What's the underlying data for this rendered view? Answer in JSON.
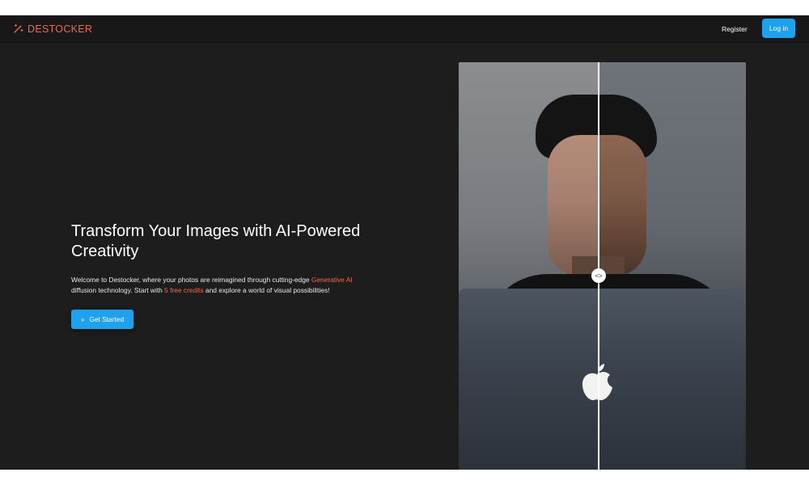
{
  "brand": {
    "name": "DESTOCKER",
    "icon": "magic-wand-icon",
    "color": "#ef6a4c"
  },
  "nav": {
    "register_label": "Register",
    "login_label": "Log in",
    "accent": "#1ea2ef"
  },
  "hero": {
    "title": "Transform Your Images with AI-Powered Creativity",
    "desc_part1": "Welcome to Destocker, where your photos are reimagined through cutting-edge ",
    "desc_highlight1": "Generative AI",
    "desc_part2": " diffusion technology. Start with ",
    "desc_highlight2": "5 free credits",
    "desc_part3": " and explore a world of visual possibilities!",
    "cta_label": "Get Started",
    "cta_icon": "double-chevron-right-icon"
  },
  "comparison": {
    "handle_icon": "code-arrows-icon",
    "split_fraction": 0.49
  }
}
